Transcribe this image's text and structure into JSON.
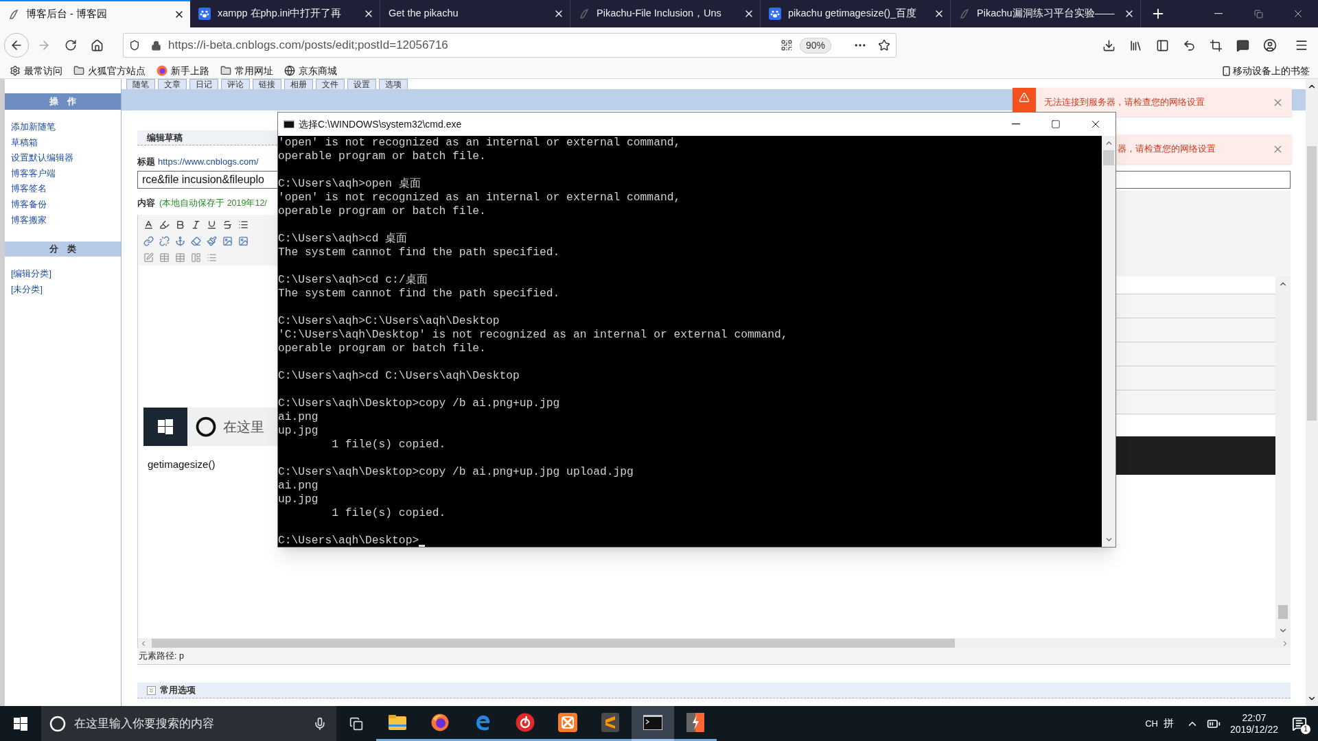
{
  "browser": {
    "tabs": [
      {
        "title": "博客后台 - 博客园",
        "kind": "blog",
        "selected": true
      },
      {
        "title": "xampp 在php.ini中打开了再",
        "kind": "paw",
        "selected": false
      },
      {
        "title": "Get the pikachu",
        "kind": "none",
        "selected": false
      },
      {
        "title": "Pikachu-File Inclusion，Uns",
        "kind": "blog",
        "selected": false
      },
      {
        "title": "pikachu getimagesize()_百度",
        "kind": "paw",
        "selected": false
      },
      {
        "title": "Pikachu漏洞练习平台实验——",
        "kind": "blog",
        "selected": false
      }
    ],
    "url": "https://i-beta.cnblogs.com/posts/edit;postId=12056716",
    "zoom": "90%",
    "bookmarks": [
      {
        "label": "最常访问",
        "kind": "gear"
      },
      {
        "label": "火狐官方站点",
        "kind": "folder"
      },
      {
        "label": "新手上路",
        "kind": "firefox"
      },
      {
        "label": "常用网址",
        "kind": "folder"
      },
      {
        "label": "京东商城",
        "kind": "globe"
      }
    ],
    "mobile_bookmarks": "移动设备上的书签"
  },
  "admin": {
    "nav_tabs": [
      "随笔",
      "文章",
      "日记",
      "评论",
      "链接",
      "相册",
      "文件",
      "设置",
      "选项"
    ],
    "sidebar": [
      {
        "title": "操　作",
        "kind": "dark",
        "links": [
          "添加新随笔",
          "草稿箱",
          "设置默认编辑器",
          "博客客户端",
          "博客签名",
          "博客备份",
          "博客搬家"
        ]
      },
      {
        "title": "分　类",
        "kind": "light",
        "links": [
          "[编辑分类]",
          "[未分类]"
        ]
      }
    ],
    "editor": {
      "header": "编辑草稿",
      "title_label": "标题",
      "title_link": "https://www.cnblogs.com/",
      "title_value": "rce&file incusion&fileuplo",
      "content_label": "内容",
      "autosave": "(本地自动保存于 2019年12/",
      "image_search": "在这里",
      "body_text": "getimagesize()",
      "element_path": "元素路径: p",
      "options": "常用选项"
    }
  },
  "notifications": [
    {
      "text": "无法连接到服务器，请检查您的网络设置",
      "warning_icon": true
    },
    {
      "text": "器，请检查您的网络设置",
      "warning_icon": false
    }
  ],
  "cmd": {
    "title": "选择C:\\WINDOWS\\system32\\cmd.exe",
    "blocks": [
      [
        "'open' is not recognized as an internal or external command,",
        "operable program or batch file."
      ],
      [
        "C:\\Users\\aqh>open 桌面",
        "'open' is not recognized as an internal or external command,",
        "operable program or batch file."
      ],
      [
        "C:\\Users\\aqh>cd 桌面",
        "The system cannot find the path specified."
      ],
      [
        "C:\\Users\\aqh>cd c:/桌面",
        "The system cannot find the path specified."
      ],
      [
        "C:\\Users\\aqh>C:\\Users\\aqh\\Desktop",
        "'C:\\Users\\aqh\\Desktop' is not recognized as an internal or external command,",
        "operable program or batch file."
      ],
      [
        "C:\\Users\\aqh>cd C:\\Users\\aqh\\Desktop"
      ],
      [
        "C:\\Users\\aqh\\Desktop>copy /b ai.png+up.jpg",
        "ai.png",
        "up.jpg",
        "        1 file(s) copied."
      ],
      [
        "C:\\Users\\aqh\\Desktop>copy /b ai.png+up.jpg upload.jpg",
        "ai.png",
        "up.jpg",
        "        1 file(s) copied."
      ],
      [
        "C:\\Users\\aqh\\Desktop>"
      ]
    ]
  },
  "taskbar": {
    "search_placeholder": "在这里输入你要搜索的内容",
    "apps": [
      {
        "kind": "explorer",
        "selected": false
      },
      {
        "kind": "firefox",
        "selected": false
      },
      {
        "kind": "edge",
        "selected": false
      },
      {
        "kind": "music",
        "selected": false
      },
      {
        "kind": "xampp",
        "selected": false
      },
      {
        "kind": "sublime",
        "selected": false
      },
      {
        "kind": "cmd",
        "selected": true
      },
      {
        "kind": "burp",
        "selected": false
      }
    ],
    "ime": [
      "CH",
      "拼"
    ],
    "time": "22:07",
    "date": "2019/12/22",
    "notification_count": "1"
  }
}
